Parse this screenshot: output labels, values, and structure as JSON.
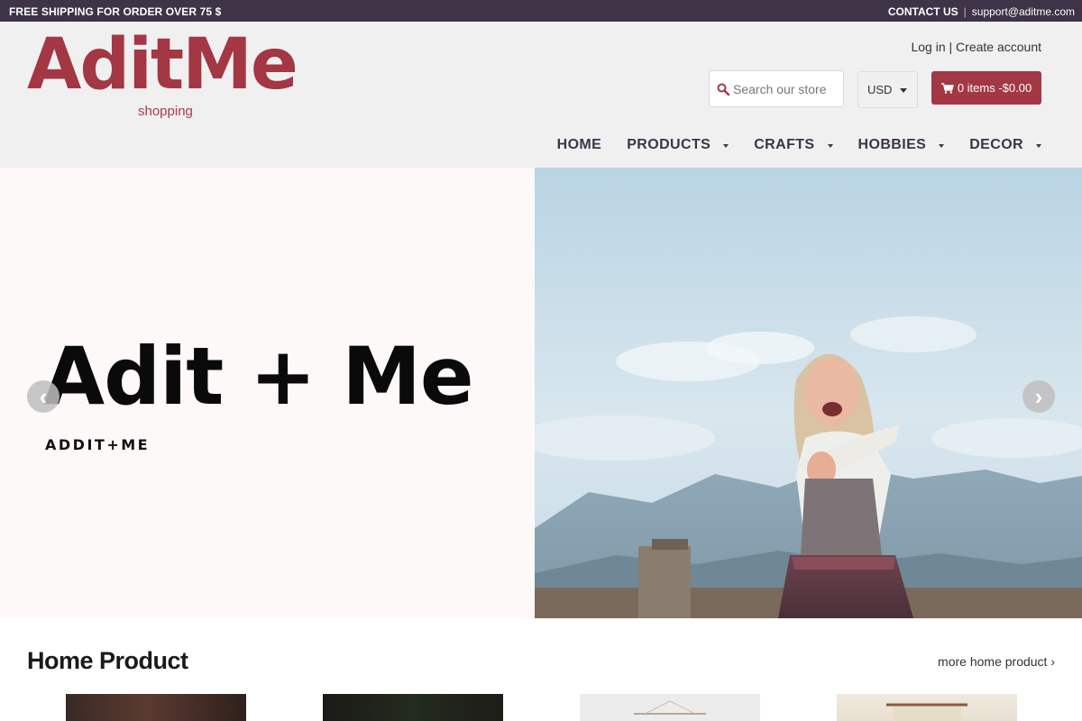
{
  "topbar": {
    "shipping_text": "FREE SHIPPING FOR ORDER OVER 75 $",
    "contact_label": "CONTACT US",
    "separator": "|",
    "email": "support@aditme.com"
  },
  "header": {
    "logo_text": "AditMe",
    "logo_tagline": "shopping",
    "login_label": "Log in",
    "account_separator": "|",
    "create_account_label": "Create account",
    "search_placeholder": "Search our store",
    "currency": "USD",
    "cart_label": "0 items -$0.00"
  },
  "nav": {
    "items": [
      {
        "label": "HOME",
        "dropdown": false
      },
      {
        "label": "PRODUCTS",
        "dropdown": true
      },
      {
        "label": "CRAFTS",
        "dropdown": true
      },
      {
        "label": "HOBBIES",
        "dropdown": true
      },
      {
        "label": "DECOR",
        "dropdown": true
      }
    ]
  },
  "hero": {
    "headline": "Adit + Me",
    "subtitle": "ADDIT+ME",
    "prev_arrow": "‹",
    "next_arrow": "›"
  },
  "home_product": {
    "title": "Home Product",
    "more_link": "more home product ›"
  },
  "colors": {
    "topbar_bg": "#3e3347",
    "brand": "#a33744",
    "header_bg": "#f0f0f0",
    "hero_left_bg": "#fcf9f8"
  },
  "icons": [
    "search-icon",
    "cart-icon",
    "chevron-left-icon",
    "chevron-right-icon",
    "dropdown-caret-icon"
  ]
}
